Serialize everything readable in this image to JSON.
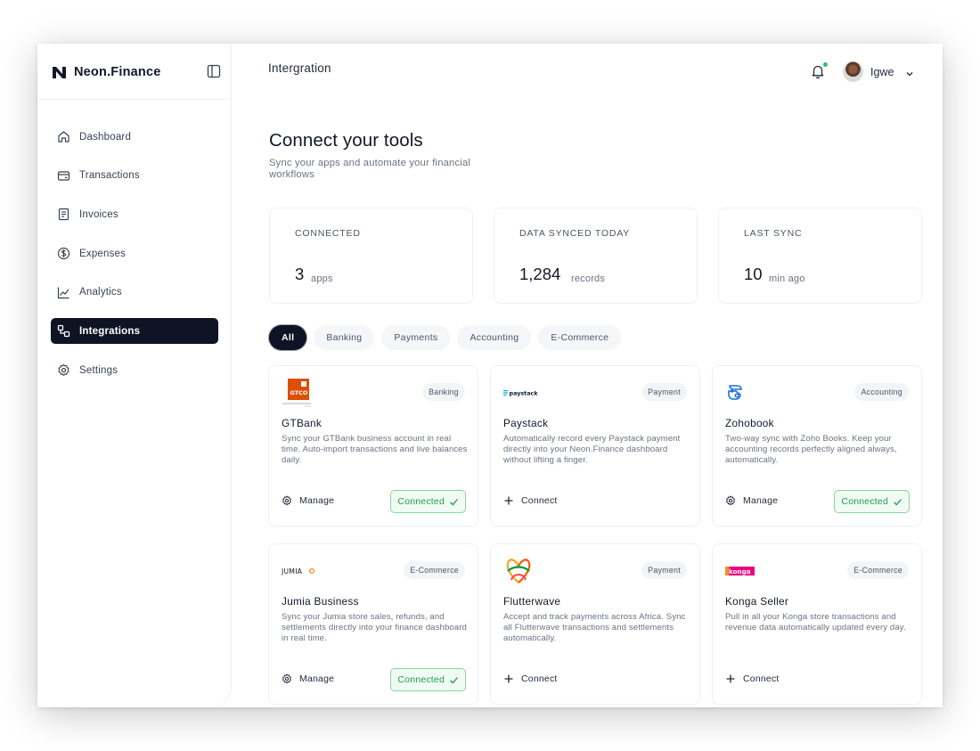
{
  "app": {
    "name": "Neon.Finance"
  },
  "sidebar": {
    "items": [
      {
        "label": "Dashboard",
        "icon": "home-icon"
      },
      {
        "label": "Transactions",
        "icon": "card-icon"
      },
      {
        "label": "Invoices",
        "icon": "document-icon"
      },
      {
        "label": "Expenses",
        "icon": "dollar-icon"
      },
      {
        "label": "Analytics",
        "icon": "chart-line-icon"
      },
      {
        "label": "Integrations",
        "icon": "integrations-icon",
        "active": true
      },
      {
        "label": "Settings",
        "icon": "gear-icon"
      }
    ]
  },
  "header": {
    "title": "Intergration",
    "user_name": "Igwe",
    "notification_dot_color": "#22c55e"
  },
  "main": {
    "heading": "Connect your tools",
    "subheading": "Sync your apps and automate your financial workflows",
    "stats": [
      {
        "label": "CONNECTED",
        "value": "3",
        "unit": "apps"
      },
      {
        "label": "DATA SYNCED TODAY",
        "value": "1,284",
        "unit": "records"
      },
      {
        "label": "LAST SYNC",
        "value": "10",
        "unit": "min ago"
      }
    ],
    "filters": [
      "All",
      "Banking",
      "Payments",
      "Accounting",
      "E-Commerce"
    ],
    "active_filter": "All",
    "cards": [
      {
        "name": "GTBank",
        "category": "Banking",
        "description": "Sync your GTBank business account in real time. Auto-import transactions and live balances daily.",
        "action": "Manage",
        "status": "Connected",
        "logo_text": "GTCO"
      },
      {
        "name": "Paystack",
        "category": "Payment",
        "description": "Automatically record every Paystack payment directly into your Neon.Finance dashboard without lifting a finger.",
        "action": "Connect",
        "status": "",
        "logo_text": "paystack"
      },
      {
        "name": "Zohobook",
        "category": "Accounting",
        "description": "Two-way sync with Zoho Books. Keep your accounting records perfectly aligned always, automatically.",
        "action": "Manage",
        "status": "Connected",
        "logo_text": ""
      },
      {
        "name": "Jumia Business",
        "category": "E-Commerce",
        "description": "Sync your Jumia store sales, refunds, and settlements directly into your finance dashboard in real time.",
        "action": "Manage",
        "status": "Connected",
        "logo_text": "JUMIA"
      },
      {
        "name": "Flutterwave",
        "category": "Payment",
        "description": "Accept and track payments across Africa. Sync all Flutterwave transactions and settlements automatically.",
        "action": "Connect",
        "status": "",
        "logo_text": ""
      },
      {
        "name": "Konga Seller",
        "category": "E-Commerce",
        "description": "Pull in all your Konga store transactions and revenue data automatically updated every day.",
        "action": "Connect",
        "status": "",
        "logo_text": "konga"
      }
    ]
  },
  "colors": {
    "primary_dark": "#0f1424",
    "connected_green": "#1e9e4d",
    "gtbank_red": "#dd4f05",
    "jumia_orange": "#f68b1e",
    "konga_pink": "#ed017f",
    "paystack_blue": "#0ba4db"
  }
}
